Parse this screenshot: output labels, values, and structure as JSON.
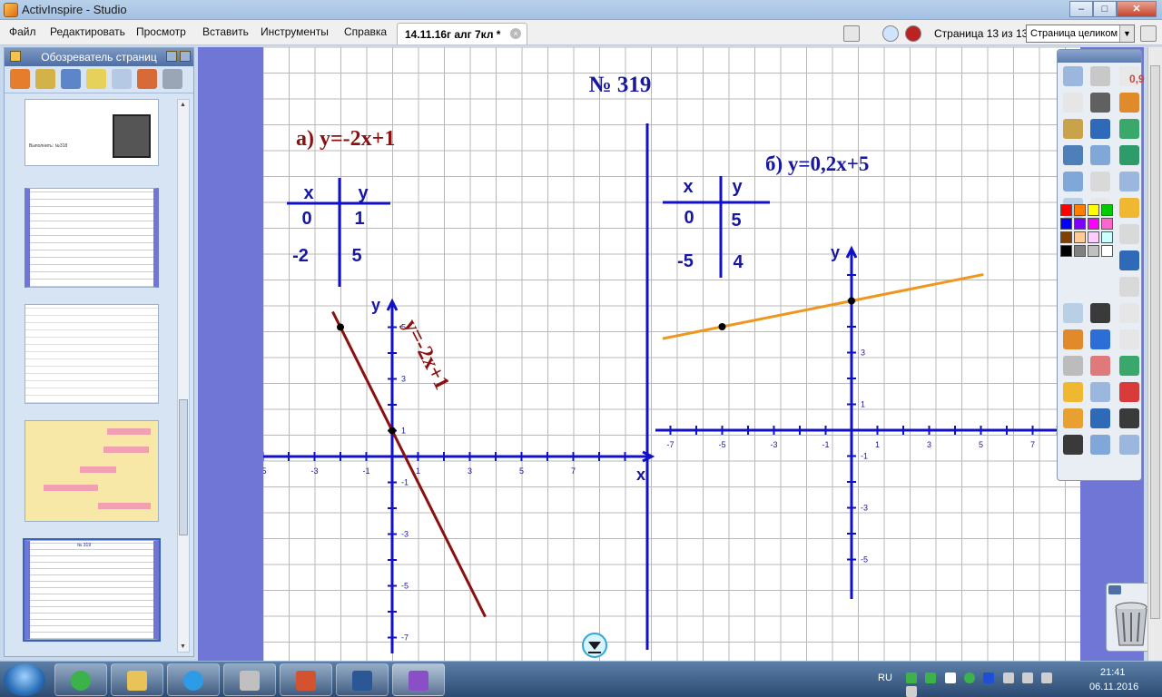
{
  "window": {
    "title": "ActivInspire - Studio",
    "min": "–",
    "max": "□",
    "close": "✕"
  },
  "menu": [
    "Файл",
    "Редактировать",
    "Просмотр",
    "Вставить",
    "Инструменты",
    "Справка"
  ],
  "document_tab": {
    "label": "14.11.16г алг 7кл *",
    "close": "×"
  },
  "page_counter": "Страница 13 из 13",
  "zoom": {
    "value": "Страница целиком",
    "arrow": "▼"
  },
  "browser": {
    "title": "Обозреватель страниц",
    "thumb1_caption": "Выполнить: №318",
    "thumb5_title": "№ 319"
  },
  "toolbox": {
    "pen_width": "0,9",
    "colors": [
      "#ff0000",
      "#ff8000",
      "#ffff00",
      "#00cc00",
      "#0000ff",
      "#8000ff",
      "#ff00ff",
      "#ff66cc",
      "#804000",
      "#ffcc99",
      "#ffccff",
      "#ccffff",
      "#000000",
      "#808080",
      "#c0c0c0",
      "#ffffff"
    ]
  },
  "flipchart": {
    "heading": "№ 319",
    "part_a": {
      "title": "а) у=-2х+1",
      "table": {
        "x_header": "х",
        "y_header": "у",
        "rows": [
          [
            "0",
            "1"
          ],
          [
            "-2",
            "5"
          ]
        ]
      },
      "axis_x": "х",
      "axis_y": "у",
      "x_ticks": [
        "-5",
        "-3",
        "-1",
        "1",
        "3",
        "5",
        "7"
      ],
      "y_ticks": [
        "5",
        "3",
        "1",
        "-1",
        "-3",
        "-5",
        "-7"
      ],
      "line_label": "у=-2х+1",
      "points": [
        [
          0,
          1
        ],
        [
          -2,
          5
        ]
      ],
      "line_color": "#8b1010"
    },
    "part_b": {
      "title": "б) у=0,2х+5",
      "table": {
        "x_header": "х",
        "y_header": "у",
        "rows": [
          [
            "0",
            "5"
          ],
          [
            "-5",
            "4"
          ]
        ]
      },
      "axis_y": "у",
      "x_ticks": [
        "-7",
        "-5",
        "-3",
        "-1",
        "1",
        "3",
        "5",
        "7"
      ],
      "y_ticks": [
        "3",
        "1",
        "-1",
        "-3",
        "-5"
      ],
      "points": [
        [
          0,
          5
        ],
        [
          -5,
          4
        ]
      ],
      "line_color": "#f0961e"
    },
    "grid_color": "#b8b8b8",
    "axis_color": "#1010c8"
  },
  "taskbar": {
    "lang": "RU",
    "time": "21:41",
    "date": "06.11.2016"
  }
}
